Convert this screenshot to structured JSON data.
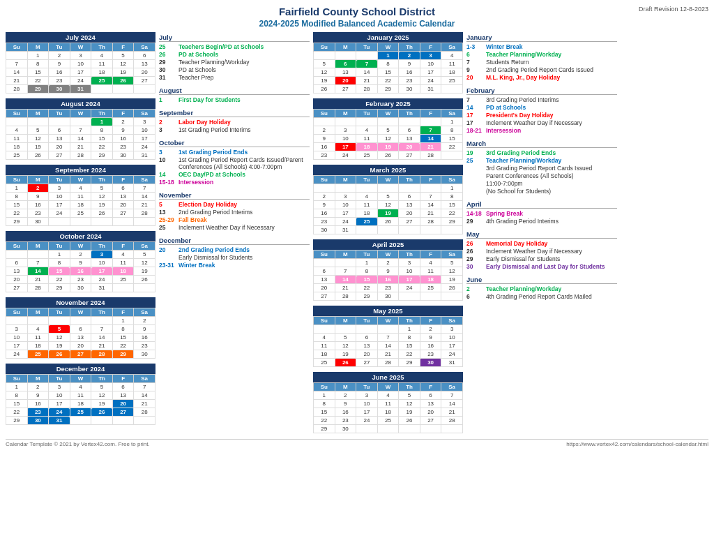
{
  "header": {
    "title": "Fairfield County School District",
    "subtitle": "2024-2025 Modified Balanced Academic Calendar",
    "draft": "Draft Revision 12-8-2023"
  },
  "months": {
    "july2024": {
      "title": "July 2024",
      "days_header": [
        "Su",
        "M",
        "Tu",
        "W",
        "Th",
        "F",
        "Sa"
      ],
      "weeks": [
        [
          null,
          1,
          2,
          3,
          4,
          5,
          6
        ],
        [
          7,
          8,
          9,
          10,
          11,
          12,
          13
        ],
        [
          14,
          15,
          16,
          17,
          18,
          19,
          20
        ],
        [
          21,
          22,
          23,
          24,
          "25",
          "26",
          27
        ],
        [
          28,
          "29",
          "30",
          "31",
          null,
          null,
          null
        ]
      ],
      "highlights": {
        "25": "green",
        "26": "green",
        "29": "gray",
        "30": "gray",
        "31": "gray"
      }
    },
    "august2024": {
      "title": "August 2024",
      "weeks": [
        [
          null,
          null,
          null,
          null,
          1,
          2,
          3
        ],
        [
          4,
          5,
          6,
          7,
          8,
          9,
          10
        ],
        [
          11,
          12,
          13,
          14,
          15,
          16,
          17
        ],
        [
          18,
          19,
          20,
          21,
          22,
          23,
          24
        ],
        [
          25,
          26,
          27,
          28,
          29,
          30,
          31
        ]
      ],
      "highlights": {
        "1": "green"
      }
    },
    "september2024": {
      "title": "September 2024",
      "weeks": [
        [
          1,
          2,
          3,
          4,
          5,
          6,
          7
        ],
        [
          8,
          9,
          10,
          11,
          12,
          13,
          14
        ],
        [
          15,
          16,
          17,
          18,
          19,
          20,
          21
        ],
        [
          22,
          23,
          24,
          25,
          26,
          27,
          28
        ],
        [
          29,
          30,
          null,
          null,
          null,
          null,
          null
        ]
      ],
      "highlights": {
        "2": "red"
      }
    },
    "october2024": {
      "title": "October 2024",
      "weeks": [
        [
          null,
          null,
          1,
          2,
          "3",
          4,
          5
        ],
        [
          6,
          7,
          8,
          9,
          10,
          11,
          12
        ],
        [
          13,
          "14",
          "15",
          "16",
          "17",
          "18",
          19
        ],
        [
          20,
          21,
          22,
          23,
          24,
          25,
          26
        ],
        [
          27,
          28,
          29,
          30,
          31,
          null,
          null
        ]
      ],
      "highlights": {
        "3": "blue",
        "14": "green",
        "15": "pink",
        "16": "pink",
        "17": "pink",
        "18": "pink"
      }
    },
    "november2024": {
      "title": "November 2024",
      "weeks": [
        [
          null,
          null,
          null,
          null,
          null,
          1,
          2
        ],
        [
          3,
          4,
          "5",
          6,
          7,
          8,
          9
        ],
        [
          10,
          11,
          12,
          13,
          14,
          15,
          16
        ],
        [
          17,
          18,
          19,
          20,
          21,
          22,
          23
        ],
        [
          24,
          "25",
          "26",
          "27",
          "28",
          "29",
          30
        ]
      ],
      "highlights": {
        "5": "red",
        "25": "orange",
        "26": "orange",
        "27": "orange",
        "28": "orange",
        "29": "orange"
      }
    },
    "december2024": {
      "title": "December 2024",
      "weeks": [
        [
          1,
          2,
          3,
          4,
          5,
          6,
          7
        ],
        [
          8,
          9,
          10,
          11,
          12,
          13,
          14
        ],
        [
          15,
          16,
          17,
          18,
          19,
          "20",
          21
        ],
        [
          22,
          "23",
          "24",
          "25",
          "26",
          "27",
          28
        ],
        [
          29,
          "30",
          "31",
          null,
          null,
          null,
          null
        ]
      ],
      "highlights": {
        "20": "blue",
        "23": "blue",
        "24": "blue",
        "25": "blue",
        "26": "blue",
        "27": "blue",
        "30": "blue",
        "31": "blue"
      }
    },
    "january2025": {
      "title": "January 2025",
      "weeks": [
        [
          null,
          null,
          null,
          1,
          2,
          3,
          4
        ],
        [
          5,
          "6",
          "7",
          8,
          9,
          10,
          11
        ],
        [
          12,
          13,
          14,
          15,
          16,
          17,
          18
        ],
        [
          19,
          "20",
          21,
          22,
          23,
          24,
          25
        ],
        [
          26,
          27,
          28,
          29,
          30,
          31,
          null
        ]
      ],
      "highlights": {
        "1": "blue",
        "2": "blue",
        "3": "blue",
        "6": "green",
        "7": "green",
        "20": "red"
      }
    },
    "february2025": {
      "title": "February 2025",
      "weeks": [
        [
          null,
          null,
          null,
          null,
          null,
          null,
          1
        ],
        [
          2,
          3,
          4,
          5,
          6,
          "7",
          8
        ],
        [
          9,
          10,
          11,
          12,
          13,
          "14",
          15
        ],
        [
          16,
          "17",
          18,
          19,
          20,
          "21",
          22
        ],
        [
          23,
          24,
          25,
          26,
          27,
          28,
          null
        ]
      ],
      "highlights": {
        "7": "green",
        "14": "blue",
        "17": "red",
        "18": "pink",
        "19": "pink",
        "20": "pink",
        "21": "pink"
      }
    },
    "march2025": {
      "title": "March 2025",
      "weeks": [
        [
          null,
          null,
          null,
          null,
          null,
          null,
          1
        ],
        [
          2,
          3,
          4,
          5,
          6,
          7,
          8
        ],
        [
          9,
          10,
          11,
          12,
          13,
          14,
          15
        ],
        [
          16,
          17,
          18,
          "19",
          20,
          21,
          22
        ],
        [
          23,
          24,
          "25",
          26,
          27,
          28,
          29
        ],
        [
          30,
          31,
          null,
          null,
          null,
          null,
          null
        ]
      ],
      "highlights": {
        "19": "green",
        "25": "blue"
      }
    },
    "april2025": {
      "title": "April 2025",
      "weeks": [
        [
          null,
          null,
          1,
          2,
          3,
          4,
          5
        ],
        [
          6,
          7,
          8,
          9,
          10,
          11,
          12
        ],
        [
          13,
          "14",
          "15",
          "16",
          "17",
          "18",
          19
        ],
        [
          20,
          21,
          22,
          23,
          24,
          25,
          26
        ],
        [
          27,
          28,
          29,
          30,
          null,
          null,
          null
        ]
      ],
      "highlights": {
        "14": "pink",
        "15": "pink",
        "16": "pink",
        "17": "pink",
        "18": "pink"
      }
    },
    "may2025": {
      "title": "May 2025",
      "weeks": [
        [
          null,
          null,
          null,
          null,
          1,
          2,
          3
        ],
        [
          4,
          5,
          6,
          7,
          8,
          9,
          10
        ],
        [
          11,
          12,
          13,
          14,
          15,
          16,
          17
        ],
        [
          18,
          19,
          20,
          21,
          22,
          23,
          24
        ],
        [
          25,
          "26",
          27,
          28,
          29,
          "30",
          31
        ]
      ],
      "highlights": {
        "26": "red",
        "30": "purple"
      }
    },
    "june2025": {
      "title": "June 2025",
      "weeks": [
        [
          1,
          2,
          3,
          4,
          5,
          6,
          7
        ],
        [
          8,
          9,
          10,
          11,
          12,
          13,
          14
        ],
        [
          15,
          16,
          17,
          18,
          19,
          20,
          21
        ],
        [
          22,
          23,
          24,
          25,
          26,
          27,
          28
        ],
        [
          29,
          30,
          null,
          null,
          null,
          null,
          null
        ]
      ],
      "highlights": {}
    }
  },
  "events": {
    "july": {
      "header": "July",
      "items": [
        {
          "date": "25",
          "text": "Teachers Begin/PD at Schools",
          "style": "green"
        },
        {
          "date": "26",
          "text": "PD at Schools",
          "style": "green"
        },
        {
          "date": "29",
          "text": "Teacher Planning/Workday",
          "style": "normal"
        },
        {
          "date": "30",
          "text": "PD at Schools",
          "style": "normal"
        },
        {
          "date": "31",
          "text": "Teacher Prep",
          "style": "normal"
        }
      ]
    },
    "august": {
      "header": "August",
      "items": [
        {
          "date": "1",
          "text": "First Day for Students",
          "style": "green"
        }
      ]
    },
    "september": {
      "header": "September",
      "items": [
        {
          "date": "2",
          "text": "Labor Day Holiday",
          "style": "red"
        },
        {
          "date": "3",
          "text": "1st Grading Period Interims",
          "style": "normal"
        }
      ]
    },
    "october": {
      "header": "October",
      "items": [
        {
          "date": "3",
          "text": "1st Grading Period Ends",
          "style": "blue"
        },
        {
          "date": "10",
          "text": "1st Grading Period Report Cards Issued/Parent Conferences (All Schools) 4:00-7:00pm",
          "style": "normal"
        },
        {
          "date": "14",
          "text": "OEC Day/PD at Schools",
          "style": "green"
        },
        {
          "date": "15-18",
          "text": "Intersession",
          "style": "pink"
        }
      ]
    },
    "november": {
      "header": "November",
      "items": [
        {
          "date": "5",
          "text": "Election Day Holiday",
          "style": "red"
        },
        {
          "date": "13",
          "text": "2nd Grading Period Interims",
          "style": "normal"
        },
        {
          "date": "25-29",
          "text": "Fall Break",
          "style": "orange"
        },
        {
          "date": "25",
          "text": "Inclement Weather Day if Necessary",
          "style": "normal"
        }
      ]
    },
    "december": {
      "header": "December",
      "items": [
        {
          "date": "20",
          "text": "2nd Grading Period Ends",
          "style": "blue"
        },
        {
          "date": "",
          "text": "Early Dismissal for Students",
          "style": "normal"
        },
        {
          "date": "23-31",
          "text": "Winter Break",
          "style": "blue"
        }
      ]
    },
    "january": {
      "header": "January",
      "items": [
        {
          "date": "1-3",
          "text": "Winter Break",
          "style": "blue"
        },
        {
          "date": "6",
          "text": "Teacher Planning/Workday",
          "style": "green"
        },
        {
          "date": "7",
          "text": "Students Return",
          "style": "normal"
        },
        {
          "date": "9",
          "text": "2nd Grading Period Report Cards Issued",
          "style": "normal"
        },
        {
          "date": "20",
          "text": "M.L. King, Jr., Day Holiday",
          "style": "red"
        }
      ]
    },
    "february": {
      "header": "February",
      "items": [
        {
          "date": "7",
          "text": "3rd Grading Period Interims",
          "style": "normal"
        },
        {
          "date": "14",
          "text": "PD at Schools",
          "style": "blue"
        },
        {
          "date": "17",
          "text": "President's Day Holiday",
          "style": "red"
        },
        {
          "date": "17",
          "text": "Inclement Weather Day if Necessary",
          "style": "normal"
        },
        {
          "date": "18-21",
          "text": "Intersession",
          "style": "pink"
        }
      ]
    },
    "march": {
      "header": "March",
      "items": [
        {
          "date": "19",
          "text": "3rd Grading Period Ends",
          "style": "green"
        },
        {
          "date": "25",
          "text": "Teacher Planning/Workday",
          "style": "blue"
        },
        {
          "date": "",
          "text": "3rd Grading Period Report Cards Issued",
          "style": "normal"
        },
        {
          "date": "",
          "text": "Parent Conferences (All Schools)",
          "style": "normal"
        },
        {
          "date": "",
          "text": "11:00-7:00pm",
          "style": "normal"
        },
        {
          "date": "",
          "text": "(No School for Students)",
          "style": "normal"
        }
      ]
    },
    "april": {
      "header": "April",
      "items": [
        {
          "date": "14-18",
          "text": "Spring Break",
          "style": "pink"
        },
        {
          "date": "29",
          "text": "4th Grading Period Interims",
          "style": "normal"
        }
      ]
    },
    "may": {
      "header": "May",
      "items": [
        {
          "date": "26",
          "text": "Memorial Day Holiday",
          "style": "red"
        },
        {
          "date": "26",
          "text": "Inclement Weather Day if Necessary",
          "style": "normal"
        },
        {
          "date": "29",
          "text": "Early Dismissal for Students",
          "style": "normal"
        },
        {
          "date": "30",
          "text": "Early Dismissal and Last Day for Students",
          "style": "purple"
        }
      ]
    },
    "june": {
      "header": "June",
      "items": [
        {
          "date": "2",
          "text": "Teacher Planning/Workday",
          "style": "green"
        },
        {
          "date": "6",
          "text": "4th Grading Period Report Cards Mailed",
          "style": "normal"
        }
      ]
    }
  },
  "footer": {
    "left": "Calendar Template © 2021 by Vertex42.com. Free to print.",
    "right": "https://www.vertex42.com/calendars/school-calendar.html"
  }
}
